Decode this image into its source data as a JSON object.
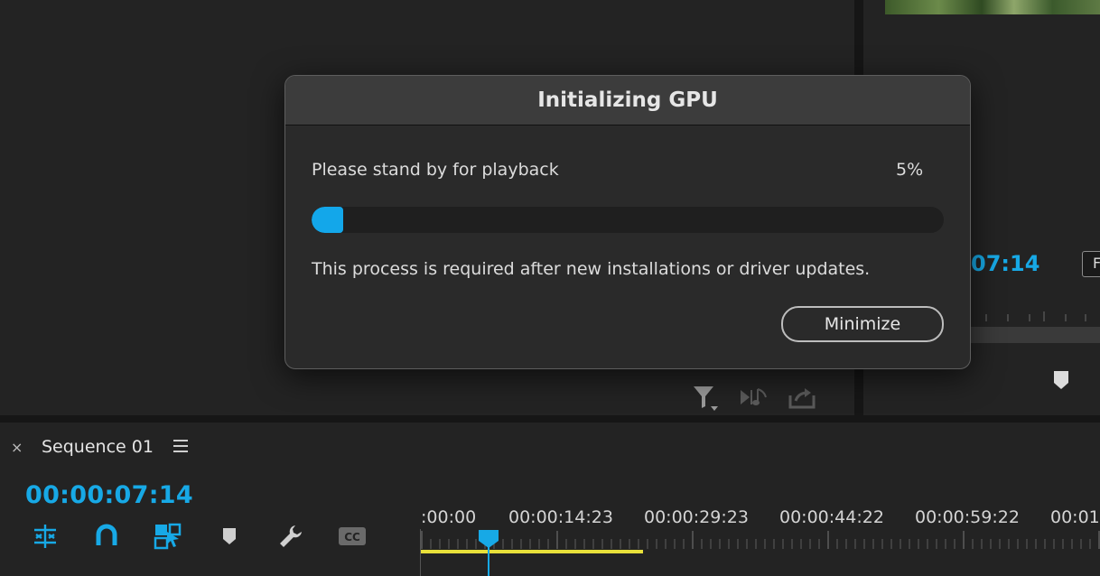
{
  "modal": {
    "title": "Initializing GPU",
    "status": "Please stand by for playback",
    "percent_label": "5%",
    "progress": 0.05,
    "message": "This process is required after new installations or driver updates.",
    "minimize_label": "Minimize"
  },
  "program": {
    "timecode_partial": "07:14",
    "box_label": "F"
  },
  "timeline": {
    "close_glyph": "×",
    "tab_title": "Sequence 01",
    "timecode": "00:00:07:14",
    "ruler_labels": [
      ":00:00",
      "00:00:14:23",
      "00:00:29:23",
      "00:00:44:22",
      "00:00:59:22",
      "00:01"
    ],
    "tools": [
      "insert-sequence-icon",
      "snap-magnet-icon",
      "linked-selection-icon",
      "add-marker-icon",
      "wrench-icon",
      "captions-icon"
    ]
  },
  "source_tools": [
    "filter-icon",
    "audio-playback-icon",
    "export-icon"
  ],
  "colors": {
    "accent_blue": "#17a9e6",
    "progress_blue": "#13a7ea",
    "work_area_yellow": "#e8e03a",
    "background": "#232323"
  }
}
